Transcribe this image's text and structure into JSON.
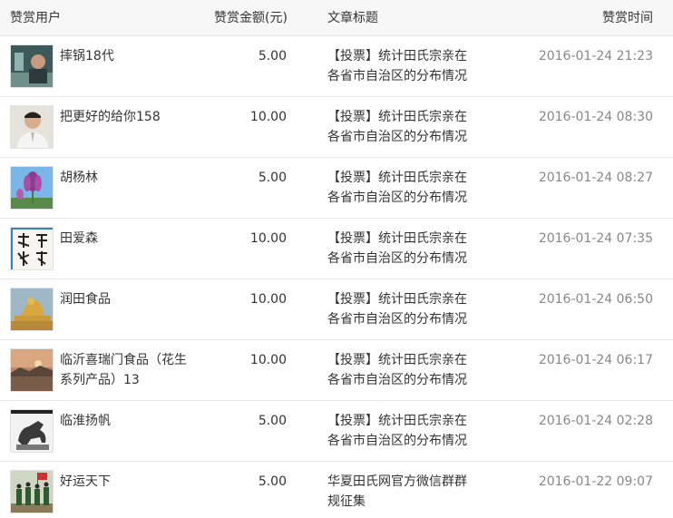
{
  "header": {
    "user": "赞赏用户",
    "amount": "赞赏金额(元)",
    "title": "文章标题",
    "time": "赞赏时间"
  },
  "rows": [
    {
      "name": "摔锅18代",
      "amount": "5.00",
      "title": "【投票】统计田氏宗亲在各省市自治区的分布情况",
      "time": "2016-01-24 21:23",
      "avatar_icon": "person-photo-avatar"
    },
    {
      "name": "把更好的给你158",
      "amount": "10.00",
      "title": "【投票】统计田氏宗亲在各省市自治区的分布情况",
      "time": "2016-01-24 08:30",
      "avatar_icon": "man-portrait-avatar"
    },
    {
      "name": "胡杨林",
      "amount": "5.00",
      "title": "【投票】统计田氏宗亲在各省市自治区的分布情况",
      "time": "2016-01-24 08:27",
      "avatar_icon": "purple-flower-avatar"
    },
    {
      "name": "田爱森",
      "amount": "10.00",
      "title": "【投票】统计田氏宗亲在各省市自治区的分布情况",
      "time": "2016-01-24 07:35",
      "avatar_icon": "calligraphy-avatar"
    },
    {
      "name": "润田食品",
      "amount": "10.00",
      "title": "【投票】统计田氏宗亲在各省市自治区的分布情况",
      "time": "2016-01-24 06:50",
      "avatar_icon": "golden-dragon-avatar"
    },
    {
      "name": "临沂喜瑞门食品（花生系列产品）13",
      "amount": "10.00",
      "title": "【投票】统计田氏宗亲在各省市自治区的分布情况",
      "time": "2016-01-24 06:17",
      "avatar_icon": "sunset-landscape-avatar"
    },
    {
      "name": "临淮扬帆",
      "amount": "5.00",
      "title": "【投票】统计田氏宗亲在各省市自治区的分布情况",
      "time": "2016-01-24 02:28",
      "avatar_icon": "horse-sculpture-avatar"
    },
    {
      "name": "好运天下",
      "amount": "5.00",
      "title": "华夏田氏网官方微信群群规征集",
      "time": "2016-01-22 09:07",
      "avatar_icon": "honor-guard-avatar"
    }
  ]
}
